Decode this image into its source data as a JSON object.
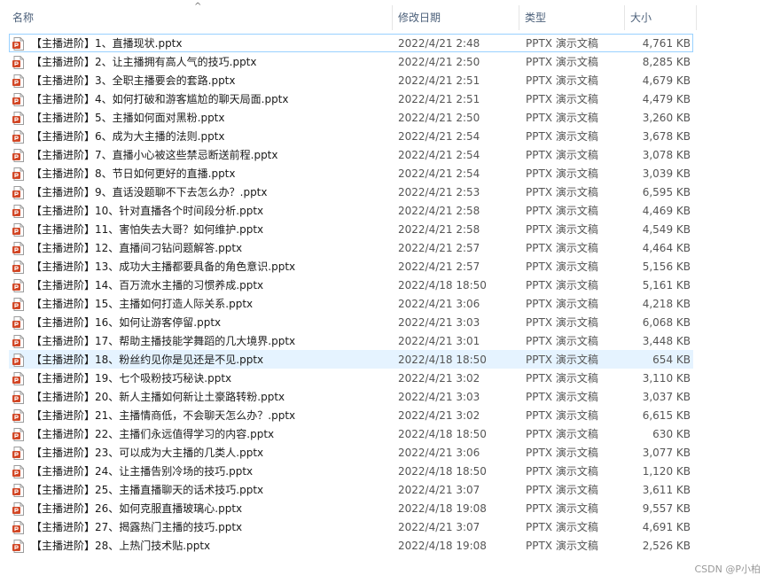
{
  "columns": {
    "name": "名称",
    "date": "修改日期",
    "type": "类型",
    "size": "大小",
    "sort_indicator": "^"
  },
  "icon": "powerpoint-file-icon",
  "accent_color": "#d24726",
  "rows": [
    {
      "name": "【主播进阶】1、直播现状.pptx",
      "date": "2022/4/21 2:48",
      "type": "PPTX 演示文稿",
      "size": "4,761 KB"
    },
    {
      "name": "【主播进阶】2、让主播拥有高人气的技巧.pptx",
      "date": "2022/4/21 2:50",
      "type": "PPTX 演示文稿",
      "size": "8,285 KB"
    },
    {
      "name": "【主播进阶】3、全职主播要会的套路.pptx",
      "date": "2022/4/21 2:51",
      "type": "PPTX 演示文稿",
      "size": "4,679 KB"
    },
    {
      "name": "【主播进阶】4、如何打破和游客尴尬的聊天局面.pptx",
      "date": "2022/4/21 2:51",
      "type": "PPTX 演示文稿",
      "size": "4,479 KB"
    },
    {
      "name": "【主播进阶】5、主播如何面对黑粉.pptx",
      "date": "2022/4/21 2:50",
      "type": "PPTX 演示文稿",
      "size": "3,260 KB"
    },
    {
      "name": "【主播进阶】6、成为大主播的法则.pptx",
      "date": "2022/4/21 2:54",
      "type": "PPTX 演示文稿",
      "size": "3,678 KB"
    },
    {
      "name": "【主播进阶】7、直播小心被这些禁忌断送前程.pptx",
      "date": "2022/4/21 2:54",
      "type": "PPTX 演示文稿",
      "size": "3,078 KB"
    },
    {
      "name": "【主播进阶】8、节日如何更好的直播.pptx",
      "date": "2022/4/21 2:54",
      "type": "PPTX 演示文稿",
      "size": "3,039 KB"
    },
    {
      "name": "【主播进阶】9、直话没题聊不下去怎么办？.pptx",
      "date": "2022/4/21 2:53",
      "type": "PPTX 演示文稿",
      "size": "6,595 KB"
    },
    {
      "name": "【主播进阶】10、针对直播各个时间段分析.pptx",
      "date": "2022/4/21 2:58",
      "type": "PPTX 演示文稿",
      "size": "4,469 KB"
    },
    {
      "name": "【主播进阶】11、害怕失去大哥？如何维护.pptx",
      "date": "2022/4/21 2:58",
      "type": "PPTX 演示文稿",
      "size": "4,549 KB"
    },
    {
      "name": "【主播进阶】12、直播间刁钻问题解答.pptx",
      "date": "2022/4/21 2:57",
      "type": "PPTX 演示文稿",
      "size": "4,464 KB"
    },
    {
      "name": "【主播进阶】13、成功大主播都要具备的角色意识.pptx",
      "date": "2022/4/21 2:57",
      "type": "PPTX 演示文稿",
      "size": "5,156 KB"
    },
    {
      "name": "【主播进阶】14、百万流水主播的习惯养成.pptx",
      "date": "2022/4/18 18:50",
      "type": "PPTX 演示文稿",
      "size": "5,161 KB"
    },
    {
      "name": "【主播进阶】15、主播如何打造人际关系.pptx",
      "date": "2022/4/21 3:06",
      "type": "PPTX 演示文稿",
      "size": "4,218 KB"
    },
    {
      "name": "【主播进阶】16、如何让游客停留.pptx",
      "date": "2022/4/21 3:03",
      "type": "PPTX 演示文稿",
      "size": "6,068 KB"
    },
    {
      "name": "【主播进阶】17、帮助主播技能学舞蹈的几大境界.pptx",
      "date": "2022/4/21 3:01",
      "type": "PPTX 演示文稿",
      "size": "3,448 KB"
    },
    {
      "name": "【主播进阶】18、粉丝约见你是见还是不见.pptx",
      "date": "2022/4/18 18:50",
      "type": "PPTX 演示文稿",
      "size": "654 KB"
    },
    {
      "name": "【主播进阶】19、七个吸粉技巧秘诀.pptx",
      "date": "2022/4/21 3:02",
      "type": "PPTX 演示文稿",
      "size": "3,110 KB"
    },
    {
      "name": "【主播进阶】20、新人主播如何新让土豪路转粉.pptx",
      "date": "2022/4/21 3:03",
      "type": "PPTX 演示文稿",
      "size": "3,037 KB"
    },
    {
      "name": "【主播进阶】21、主播情商低，不会聊天怎么办？.pptx",
      "date": "2022/4/21 3:02",
      "type": "PPTX 演示文稿",
      "size": "6,615 KB"
    },
    {
      "name": "【主播进阶】22、主播们永远值得学习的内容.pptx",
      "date": "2022/4/18 18:50",
      "type": "PPTX 演示文稿",
      "size": "630 KB"
    },
    {
      "name": "【主播进阶】23、可以成为大主播的几类人.pptx",
      "date": "2022/4/21 3:06",
      "type": "PPTX 演示文稿",
      "size": "3,077 KB"
    },
    {
      "name": "【主播进阶】24、让主播告别冷场的技巧.pptx",
      "date": "2022/4/18 18:50",
      "type": "PPTX 演示文稿",
      "size": "1,120 KB"
    },
    {
      "name": "【主播进阶】25、主播直播聊天的话术技巧.pptx",
      "date": "2022/4/21 3:07",
      "type": "PPTX 演示文稿",
      "size": "3,611 KB"
    },
    {
      "name": "【主播进阶】26、如何克服直播玻璃心.pptx",
      "date": "2022/4/18 19:08",
      "type": "PPTX 演示文稿",
      "size": "9,557 KB"
    },
    {
      "name": "【主播进阶】27、揭露热门主播的技巧.pptx",
      "date": "2022/4/21 3:07",
      "type": "PPTX 演示文稿",
      "size": "4,691 KB"
    },
    {
      "name": "【主播进阶】28、上热门技术贴.pptx",
      "date": "2022/4/18 19:08",
      "type": "PPTX 演示文稿",
      "size": "2,526 KB"
    }
  ],
  "focused_row": 0,
  "selected_row": 17,
  "watermark": "CSDN @P小柏"
}
